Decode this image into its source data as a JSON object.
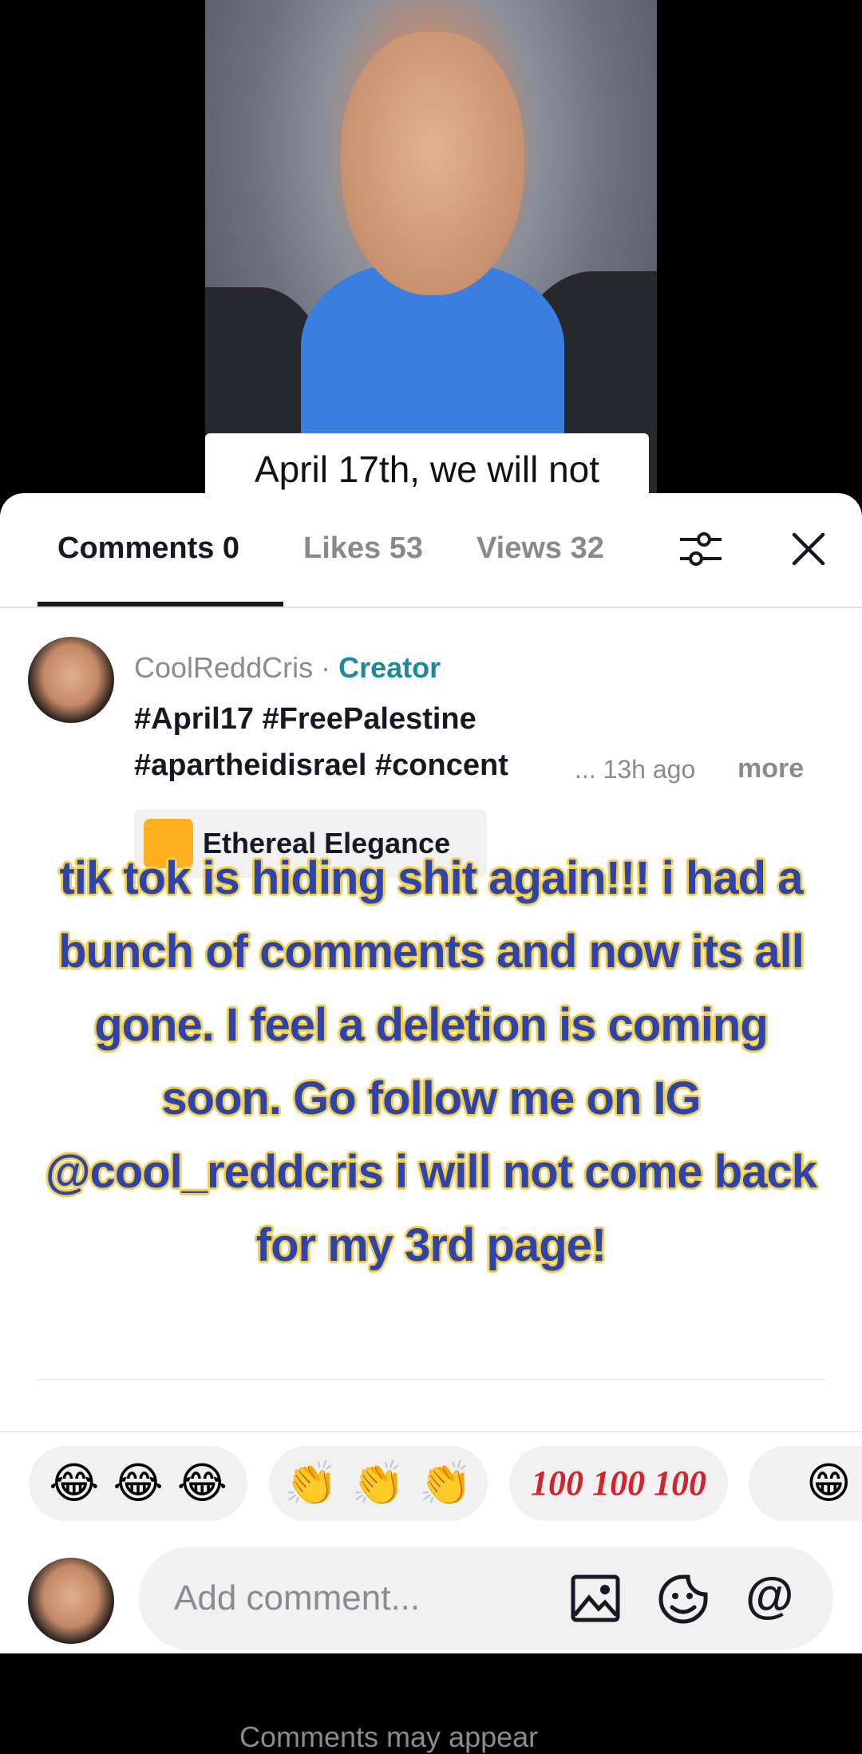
{
  "video": {
    "caption": "April 17th, we will not"
  },
  "tabs": [
    {
      "label": "Comments 0"
    },
    {
      "label": "Likes 53"
    },
    {
      "label": "Views 32"
    }
  ],
  "comment": {
    "username": "CoolReddCris",
    "separator": " · ",
    "badge": "Creator",
    "line1": "#April17 #FreePalestine",
    "line2": "#apartheidisrael #concent",
    "ellipsis": "...",
    "time": "13h ago",
    "more": "more",
    "effect": "Ethereal Elegance"
  },
  "hidden_note": "Comments may appear",
  "overlay_text": "tik tok is hiding shit again!!! i had a bunch of comments and now its all gone. I feel a deletion is coming soon. Go follow me on IG @cool_reddcris i will not come back for my 3rd page!",
  "quick_reactions": [
    {
      "emoji": "😂 😂 😂"
    },
    {
      "emoji": "👏 👏 👏"
    },
    {
      "emoji": "100 100 100"
    },
    {
      "emoji": "😁 😁"
    }
  ],
  "input": {
    "placeholder": "Add comment...",
    "mention": "@"
  },
  "colors": {
    "creator": "#1b8a9a",
    "overlay_fill": "#2f44a8",
    "overlay_stroke": "#f1cf57"
  }
}
